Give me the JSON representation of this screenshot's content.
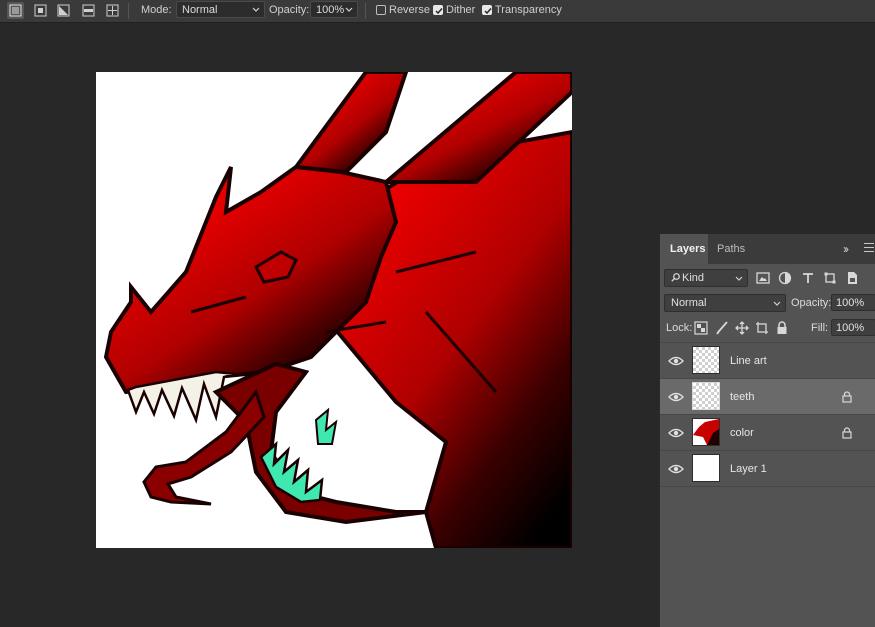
{
  "options_bar": {
    "gradient_modes": [
      {
        "name": "linear-gradient",
        "active": true
      },
      {
        "name": "radial-gradient",
        "active": false
      },
      {
        "name": "angle-gradient",
        "active": false
      },
      {
        "name": "reflected-gradient",
        "active": false
      },
      {
        "name": "diamond-gradient",
        "active": false
      }
    ],
    "mode_label": "Mode:",
    "mode_value": "Normal",
    "opacity_label": "Opacity:",
    "opacity_value": "100%",
    "reverse_label": "Reverse",
    "reverse_checked": false,
    "dither_label": "Dither",
    "dither_checked": true,
    "transparency_label": "Transparency",
    "transparency_checked": true
  },
  "layers_panel": {
    "tabs": [
      {
        "label": "Layers",
        "active": true
      },
      {
        "label": "Paths",
        "active": false
      }
    ],
    "more_icon": "double-chevron-right-icon",
    "filter": {
      "kind_value": "Kind",
      "icons": [
        "image-filter-icon",
        "adjustment-filter-icon",
        "type-filter-icon",
        "shape-filter-icon",
        "smart-object-filter-icon"
      ]
    },
    "blend_mode": "Normal",
    "opacity_label": "Opacity:",
    "opacity_value": "100%",
    "lock_label": "Lock:",
    "lock_icons": [
      "lock-transparent-pixels-icon",
      "lock-image-pixels-icon",
      "lock-position-icon",
      "lock-artboard-icon",
      "lock-all-icon"
    ],
    "fill_label": "Fill:",
    "fill_value": "100%",
    "layers": [
      {
        "name": "Line art",
        "visible": true,
        "locked": false,
        "selected": false,
        "thumb": "transparent"
      },
      {
        "name": "teeth",
        "visible": true,
        "locked": true,
        "selected": true,
        "thumb": "transparent"
      },
      {
        "name": "color",
        "visible": true,
        "locked": true,
        "selected": false,
        "thumb": "red-dragon"
      },
      {
        "name": "Layer 1",
        "visible": true,
        "locked": false,
        "selected": false,
        "thumb": "white"
      }
    ]
  },
  "colors": {
    "workspace_bg": "#282828",
    "panel_bg": "#535353",
    "selected_layer": "#6a6a6a",
    "dragon_red": "#e80000",
    "dragon_dark": "#000000",
    "teeth_green": "#3ee8b0"
  }
}
